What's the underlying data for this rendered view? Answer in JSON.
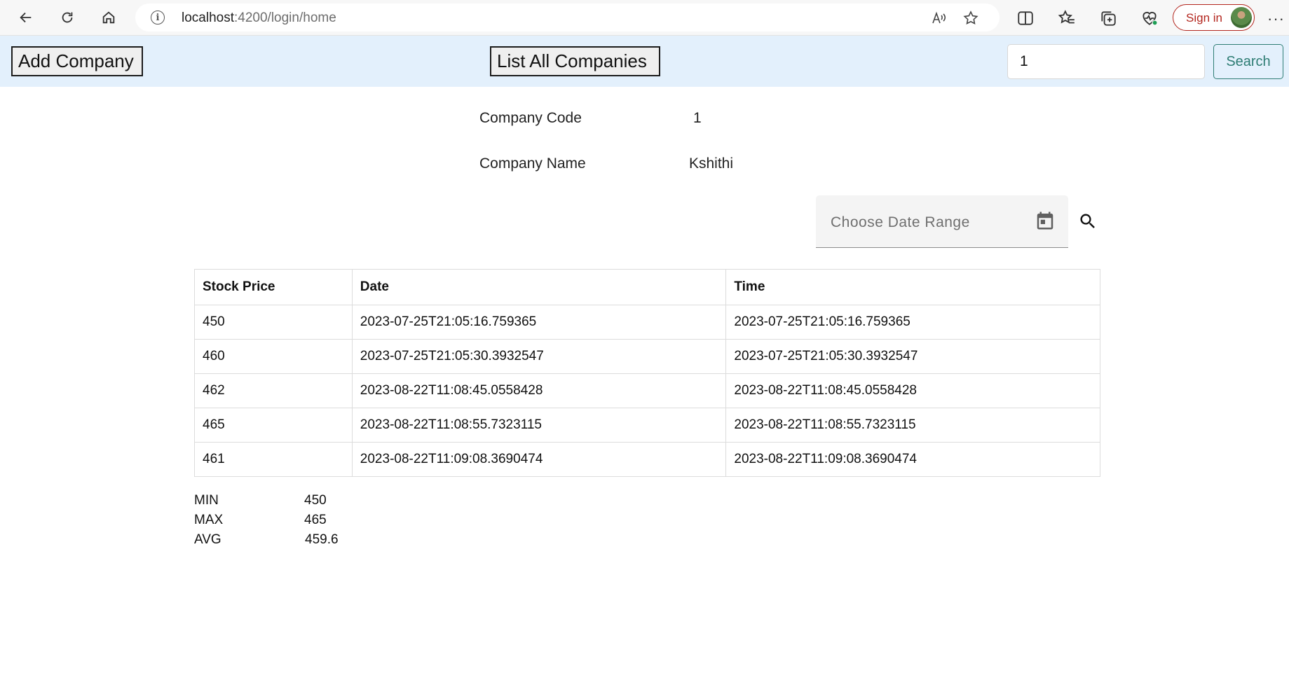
{
  "browser": {
    "url_host": "localhost",
    "url_rest": ":4200/login/home",
    "signin_label": "Sign in",
    "icons": [
      "back-icon",
      "refresh-icon",
      "home-icon",
      "info-icon",
      "read-aloud-icon",
      "favorite-star-icon",
      "split-screen-icon",
      "favorites-icon",
      "collections-icon",
      "browser-essentials-icon",
      "more-icon"
    ]
  },
  "toolbar": {
    "add_company_label": "Add Company",
    "list_all_label": "List All Companies",
    "search_value": "1",
    "search_button_label": "Search"
  },
  "company": {
    "code_label": "Company Code",
    "code_value": "1",
    "name_label": "Company Name",
    "name_value": "Kshithi"
  },
  "date_filter": {
    "placeholder": "Choose Date Range"
  },
  "table": {
    "headers": [
      "Stock Price",
      "Date",
      "Time"
    ],
    "rows": [
      [
        "450",
        "2023-07-25T21:05:16.759365",
        "2023-07-25T21:05:16.759365"
      ],
      [
        "460",
        "2023-07-25T21:05:30.3932547",
        "2023-07-25T21:05:30.3932547"
      ],
      [
        "462",
        "2023-08-22T11:08:45.0558428",
        "2023-08-22T11:08:45.0558428"
      ],
      [
        "465",
        "2023-08-22T11:08:55.7323115",
        "2023-08-22T11:08:55.7323115"
      ],
      [
        "461",
        "2023-08-22T11:09:08.3690474",
        "2023-08-22T11:09:08.3690474"
      ]
    ]
  },
  "stats": {
    "min_label": "MIN",
    "min_value": "450",
    "max_label": "MAX",
    "max_value": "465",
    "avg_label": "AVG",
    "avg_value": "459.6"
  },
  "colors": {
    "toolbar_bg": "#e3f0fc",
    "search_accent": "#2e7d74",
    "signin_accent": "#b3261e"
  }
}
